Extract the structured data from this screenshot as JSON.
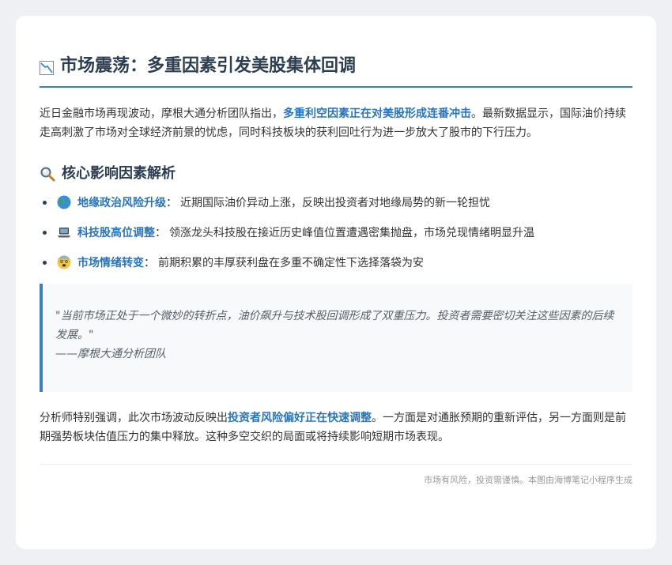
{
  "article": {
    "title_icon": "chart-decreasing-icon",
    "title": "市场震荡：多重因素引发美股集体回调",
    "intro": {
      "before": "近日金融市场再现波动，摩根大通分析团队指出，",
      "highlight": "多重利空因素正在对美股形成连番冲击",
      "after": "。最新数据显示，国际油价持续走高刺激了市场对全球经济前景的忧虑，同时科技板块的获利回吐行为进一步放大了股市的下行压力。"
    },
    "section": {
      "icon": "magnifying-glass-icon",
      "title": "核心影响因素解析"
    },
    "factors": [
      {
        "icon": "globe-icon",
        "name": "地缘政治风险升级",
        "sep": "：",
        "desc": "近期国际油价异动上涨，反映出投资者对地缘局势的新一轮担忧"
      },
      {
        "icon": "laptop-icon",
        "name": "科技股高位调整",
        "sep": "：",
        "desc": "领涨龙头科技股在接近历史峰值位置遭遇密集抛盘，市场兑现情绪明显升温"
      },
      {
        "icon": "fearful-face-icon",
        "name": "市场情绪转变",
        "sep": "：",
        "desc": "前期积累的丰厚获利盘在多重不确定性下选择落袋为安"
      }
    ],
    "quote": {
      "text": "\"当前市场正处于一个微妙的转折点，油价飙升与技术股回调形成了双重压力。投资者需要密切关注这些因素的后续发展。\"",
      "author": "——摩根大通分析团队"
    },
    "analysis": {
      "before": "分析师特别强调，此次市场波动反映出",
      "highlight": "投资者风险偏好正在快速调整",
      "after": "。一方面是对通胀预期的重新评估，另一方面则是前期强势板块估值压力的集中释放。这种多空交织的局面或将持续影响短期市场表现。"
    },
    "footer": "市场有风险，投资需谨慎。本图由海博笔记小程序生成"
  },
  "colors": {
    "accent": "#2a74b8",
    "border": "#3b7fc0",
    "heading": "#2c3e50",
    "page_bg": "#eef0f3",
    "card_bg": "#ffffff",
    "quote_bg": "#f7f9fb"
  }
}
